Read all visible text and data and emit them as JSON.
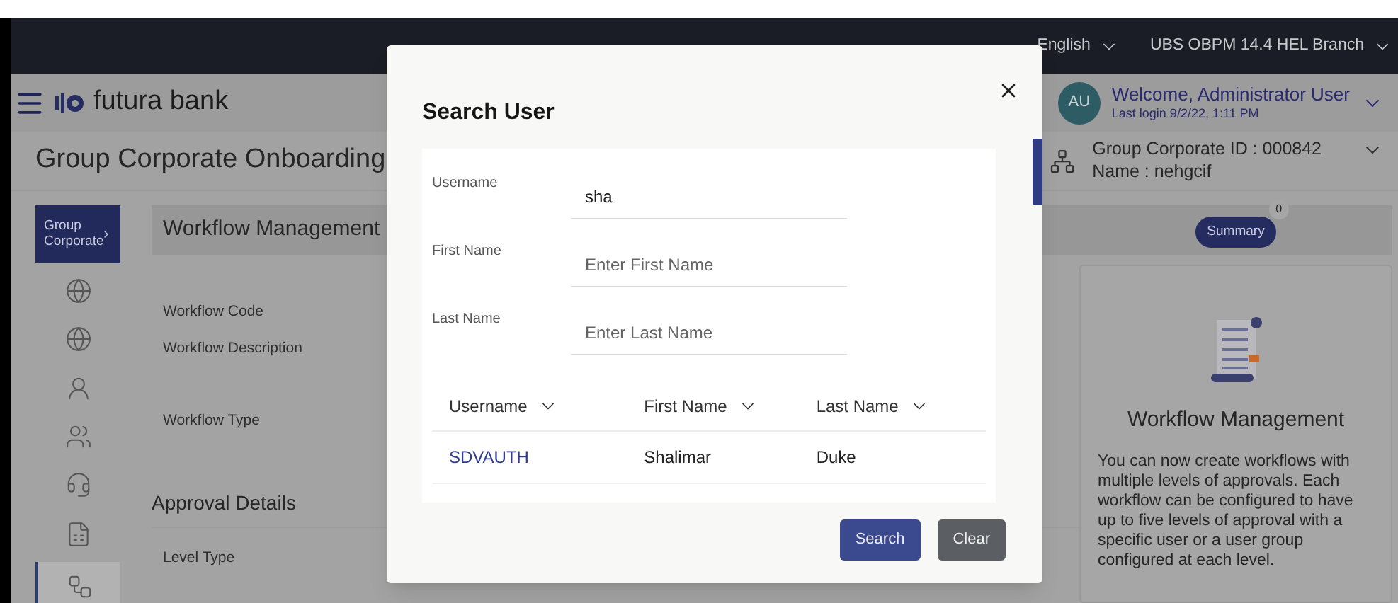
{
  "top_bar": {
    "items": [
      {
        "label": "English",
        "kind": "dropdown"
      },
      {
        "label": "UBS OBPM 14.4 HEL Branch",
        "kind": "dropdown"
      }
    ]
  },
  "header": {
    "brand": "futura bank",
    "avatar": "AU",
    "welcome": "Welcome, Administrator User",
    "last_login": "Last login 9/2/22, 1:11 PM"
  },
  "page_title": "Group Corporate Onboarding",
  "group_corporate": {
    "id": "Group Corporate ID : 000842",
    "name": "Name : nehgcif"
  },
  "sidebar": {
    "active_label": "Group Corporate",
    "items": [
      {
        "kind": "globe",
        "selected": false
      },
      {
        "kind": "globe-user",
        "selected": false
      },
      {
        "kind": "user",
        "selected": false
      },
      {
        "kind": "users",
        "selected": false
      },
      {
        "kind": "headset",
        "selected": false
      },
      {
        "kind": "report",
        "selected": false
      },
      {
        "kind": "workflow",
        "selected": true
      }
    ]
  },
  "main": {
    "section_title": "Workflow Management",
    "summary": {
      "label": "Summary",
      "count": "0"
    },
    "fields": [
      "Workflow Code",
      "Workflow Description",
      "Workflow Type"
    ],
    "approval_title": "Approval Details",
    "level_type_label": "Level Type"
  },
  "info_card": {
    "title": "Workflow Management",
    "body": "You can now create workflows with multiple levels of approvals. Each workflow can be configured to have up to five levels of approval with a specific user or a user group configured at each level."
  },
  "modal": {
    "title": "Search User",
    "fields": [
      {
        "label": "Username",
        "value": "sha"
      },
      {
        "label": "First Name",
        "placeholder": "Enter First Name"
      },
      {
        "label": "Last Name",
        "placeholder": "Enter Last Name"
      }
    ],
    "table": {
      "columns": [
        "Username",
        "First Name",
        "Last Name"
      ],
      "rows": [
        [
          "SDVAUTH",
          "Shalimar",
          "Duke"
        ]
      ]
    },
    "buttons": [
      {
        "label": "Search",
        "kind": "primary"
      },
      {
        "label": "Clear",
        "kind": "secondary"
      }
    ]
  }
}
